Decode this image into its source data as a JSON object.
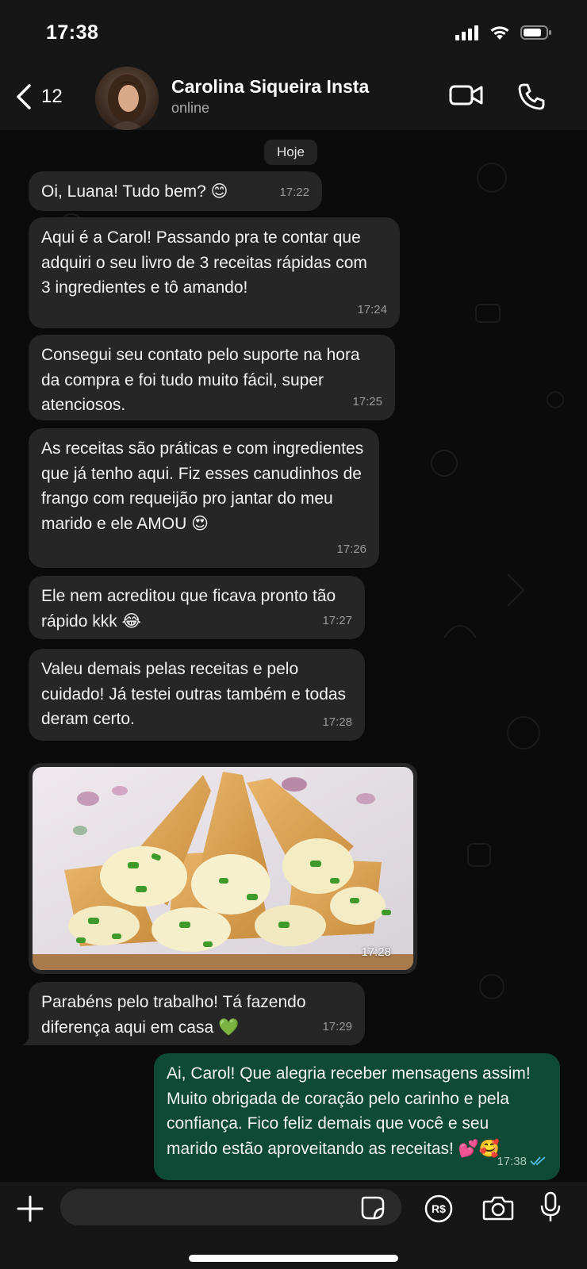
{
  "status_bar": {
    "time": "17:38"
  },
  "header": {
    "back_count": "12",
    "contact_name": "Carolina Siqueira Insta",
    "contact_status": "online"
  },
  "chat": {
    "date_chip": "Hoje",
    "messages": [
      {
        "text": "Oi, Luana! Tudo bem? 😊",
        "time": "17:22"
      },
      {
        "text": "Aqui é a Carol! Passando pra te contar que adquiri o seu livro de 3 receitas rápidas com 3 ingredientes e tô amando!",
        "time": "17:24"
      },
      {
        "text": "Consegui seu contato pelo suporte na hora da compra e foi tudo muito fácil, super atenciosos.",
        "time": "17:25"
      },
      {
        "text": "As receitas são práticas e com ingredientes que já tenho aqui. Fiz esses canudinhos de frango com requeijão pro jantar do meu marido e ele AMOU 😍",
        "time": "17:26"
      },
      {
        "text": "Ele nem acreditou que ficava pronto tão rápido kkk 😂",
        "time": "17:27"
      },
      {
        "text": "Valeu demais pelas receitas e pelo cuidado! Já testei outras também e todas deram certo.",
        "time": "17:28"
      },
      {
        "photo_time": "17:28"
      },
      {
        "text": "Parabéns pelo trabalho! Tá fazendo diferença aqui em casa 💚",
        "time": "17:29"
      }
    ],
    "outgoing": {
      "text": "Ai, Carol! Que alegria receber mensagens assim! Muito obrigada de coração pelo carinho e pela confiança. Fico feliz demais que você e seu marido estão aproveitando as receitas! 💕🥰",
      "time": "17:38"
    }
  },
  "composer": {
    "input_value": "",
    "payment_label": "R$"
  },
  "colors": {
    "incoming_bubble": "#262626",
    "outgoing_bubble": "#0e4a35",
    "background": "#0b0b0b",
    "read_tick": "#53bdeb"
  }
}
